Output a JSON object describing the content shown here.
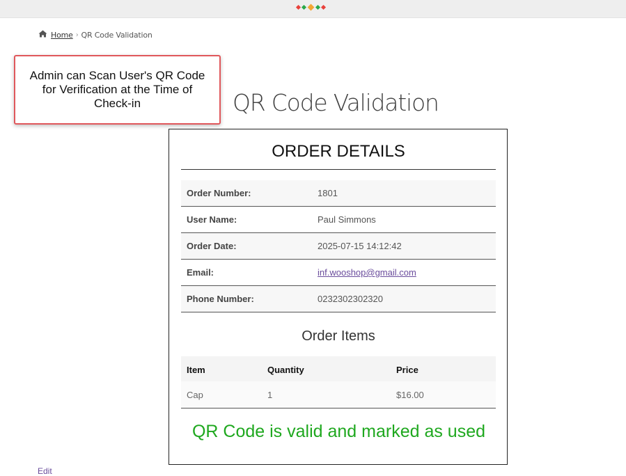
{
  "breadcrumb": {
    "home": "Home",
    "separator": "›",
    "current": "QR Code Validation"
  },
  "callout": {
    "text": "Admin can Scan User's QR Code for Verification at the Time of Check-in"
  },
  "page": {
    "title": "QR Code Validation"
  },
  "order": {
    "heading": "ORDER DETAILS",
    "details": [
      {
        "label": "Order Number:",
        "value": "1801"
      },
      {
        "label": "User Name:",
        "value": "Paul Simmons"
      },
      {
        "label": "Order Date:",
        "value": "2025-07-15 14:12:42"
      },
      {
        "label": "Email:",
        "value": "inf.wooshop@gmail.com"
      },
      {
        "label": "Phone Number:",
        "value": "0232302302320"
      }
    ],
    "items_heading": "Order Items",
    "items_columns": [
      "Item",
      "Quantity",
      "Price"
    ],
    "items": [
      {
        "item": "Cap",
        "quantity": "1",
        "price": "$16.00"
      }
    ],
    "status_message": "QR Code is valid and marked as used"
  },
  "footer": {
    "edit_label": "Edit"
  },
  "colors": {
    "accent_green": "#1fa81f",
    "link_purple": "#6a4c9c",
    "callout_border": "#e0575b"
  },
  "icons": {
    "home": "home-icon"
  }
}
